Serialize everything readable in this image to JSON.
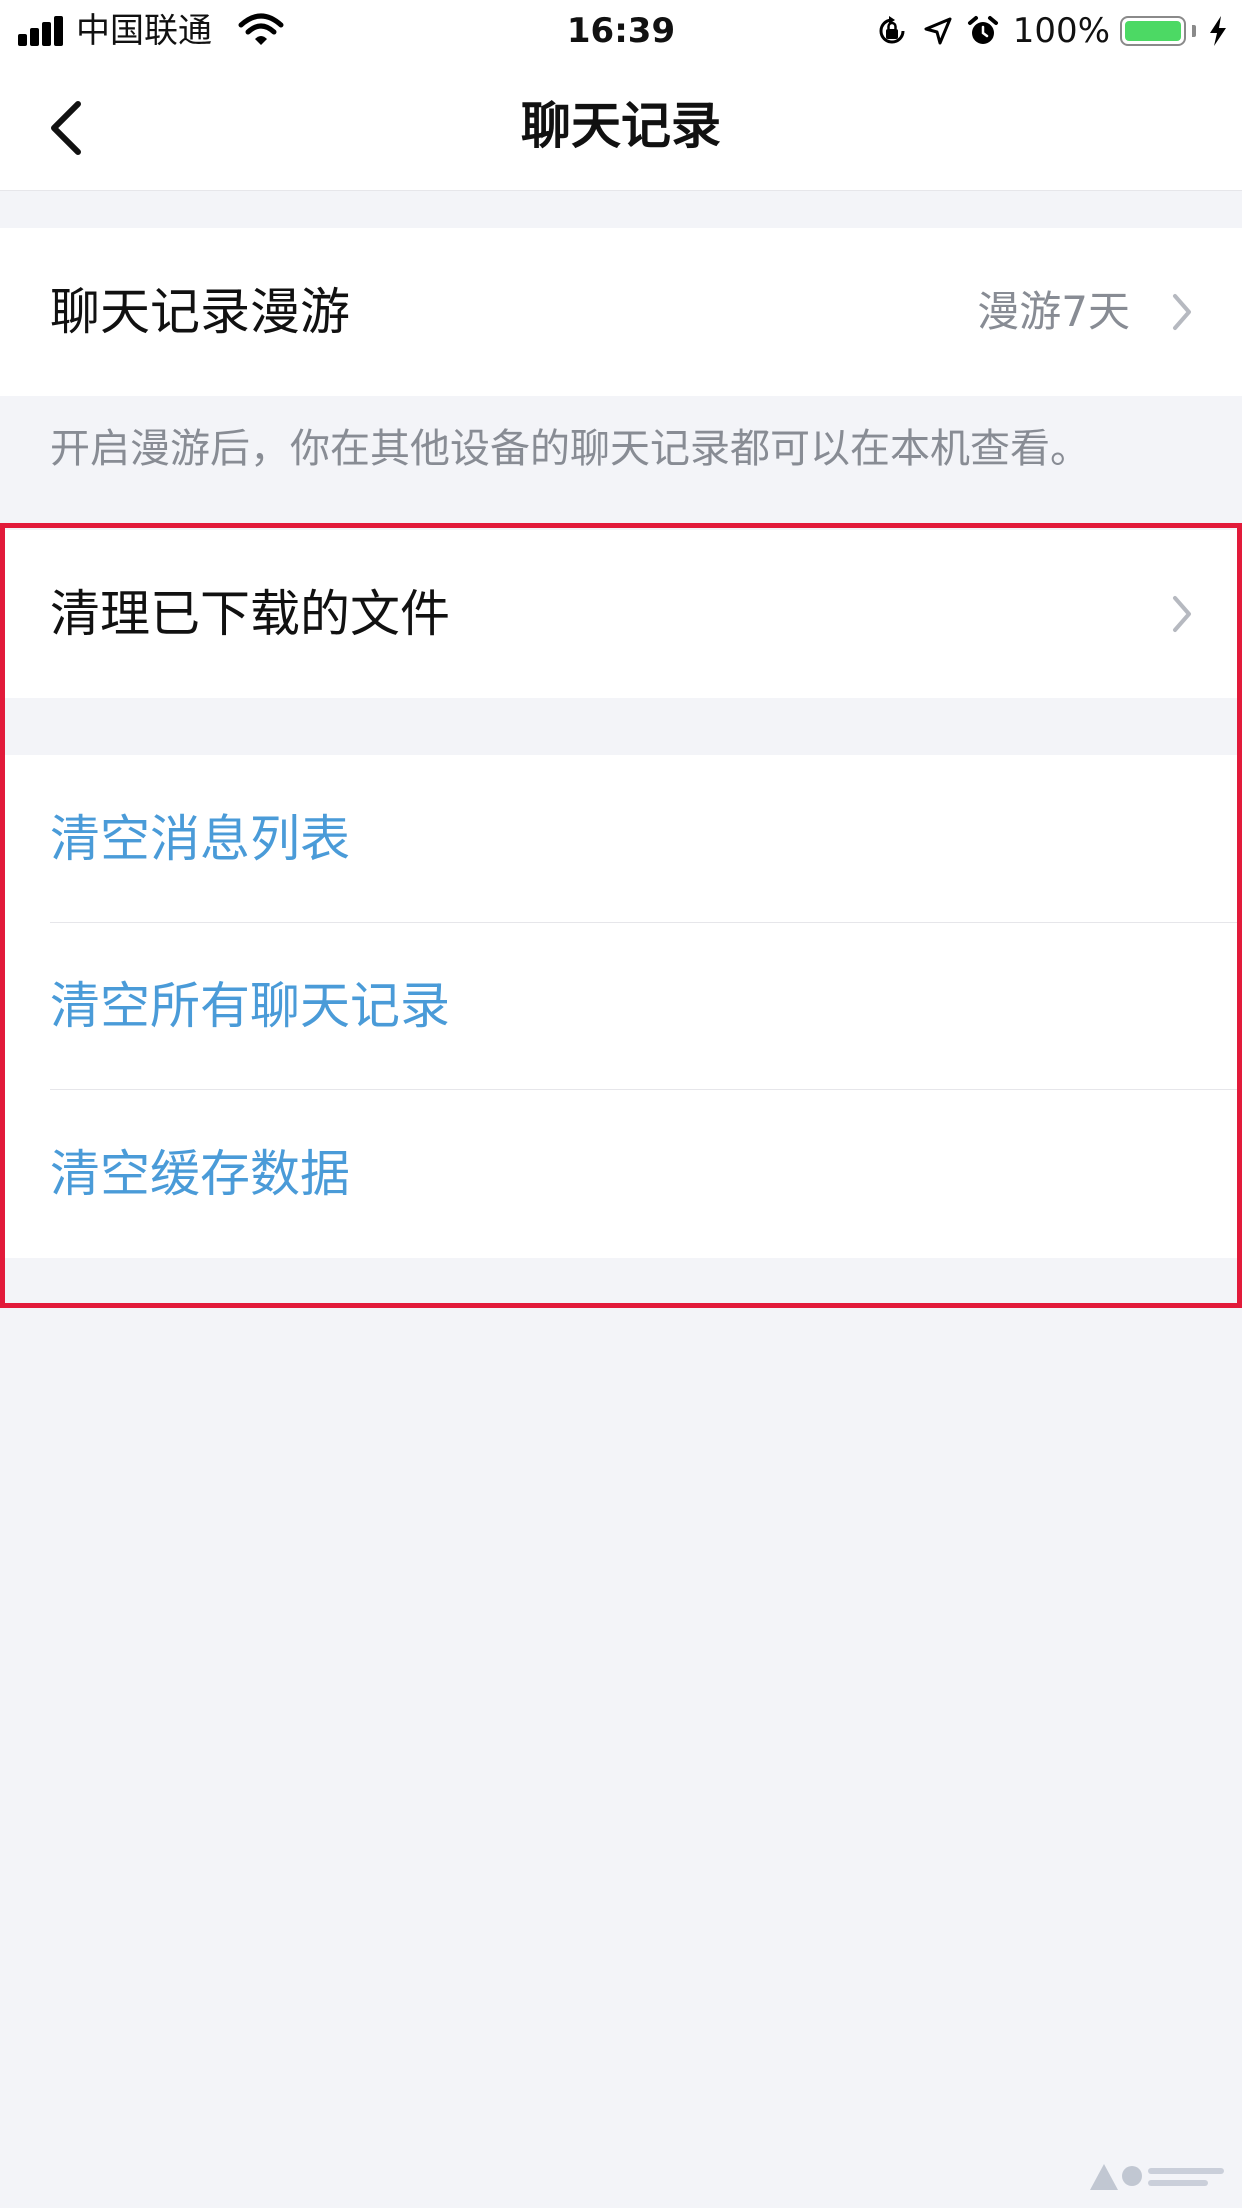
{
  "status_bar": {
    "carrier": "中国联通",
    "time": "16:39",
    "battery_percent": "100%",
    "battery_level": 1.0,
    "icons": [
      "cellular-signal-icon",
      "wifi-icon",
      "rotation-lock-icon",
      "location-arrow-icon",
      "alarm-clock-icon",
      "battery-icon",
      "charging-bolt-icon"
    ]
  },
  "nav": {
    "title": "聊天记录",
    "back_icon": "chevron-left-icon"
  },
  "section_roaming": {
    "label": "聊天记录漫游",
    "value": "漫游7天",
    "footnote": "开启漫游后，你在其他设备的聊天记录都可以在本机查看。"
  },
  "section_files": {
    "label": "清理已下载的文件"
  },
  "section_clear": {
    "items": [
      {
        "label": "清空消息列表"
      },
      {
        "label": "清空所有聊天记录"
      },
      {
        "label": "清空缓存数据"
      }
    ]
  },
  "colors": {
    "background": "#f3f4f8",
    "cell_background": "#ffffff",
    "action_blue": "#4a9bd8",
    "secondary_text": "#888c94",
    "highlight_red": "#e21a3a",
    "battery_green": "#4cd964"
  }
}
